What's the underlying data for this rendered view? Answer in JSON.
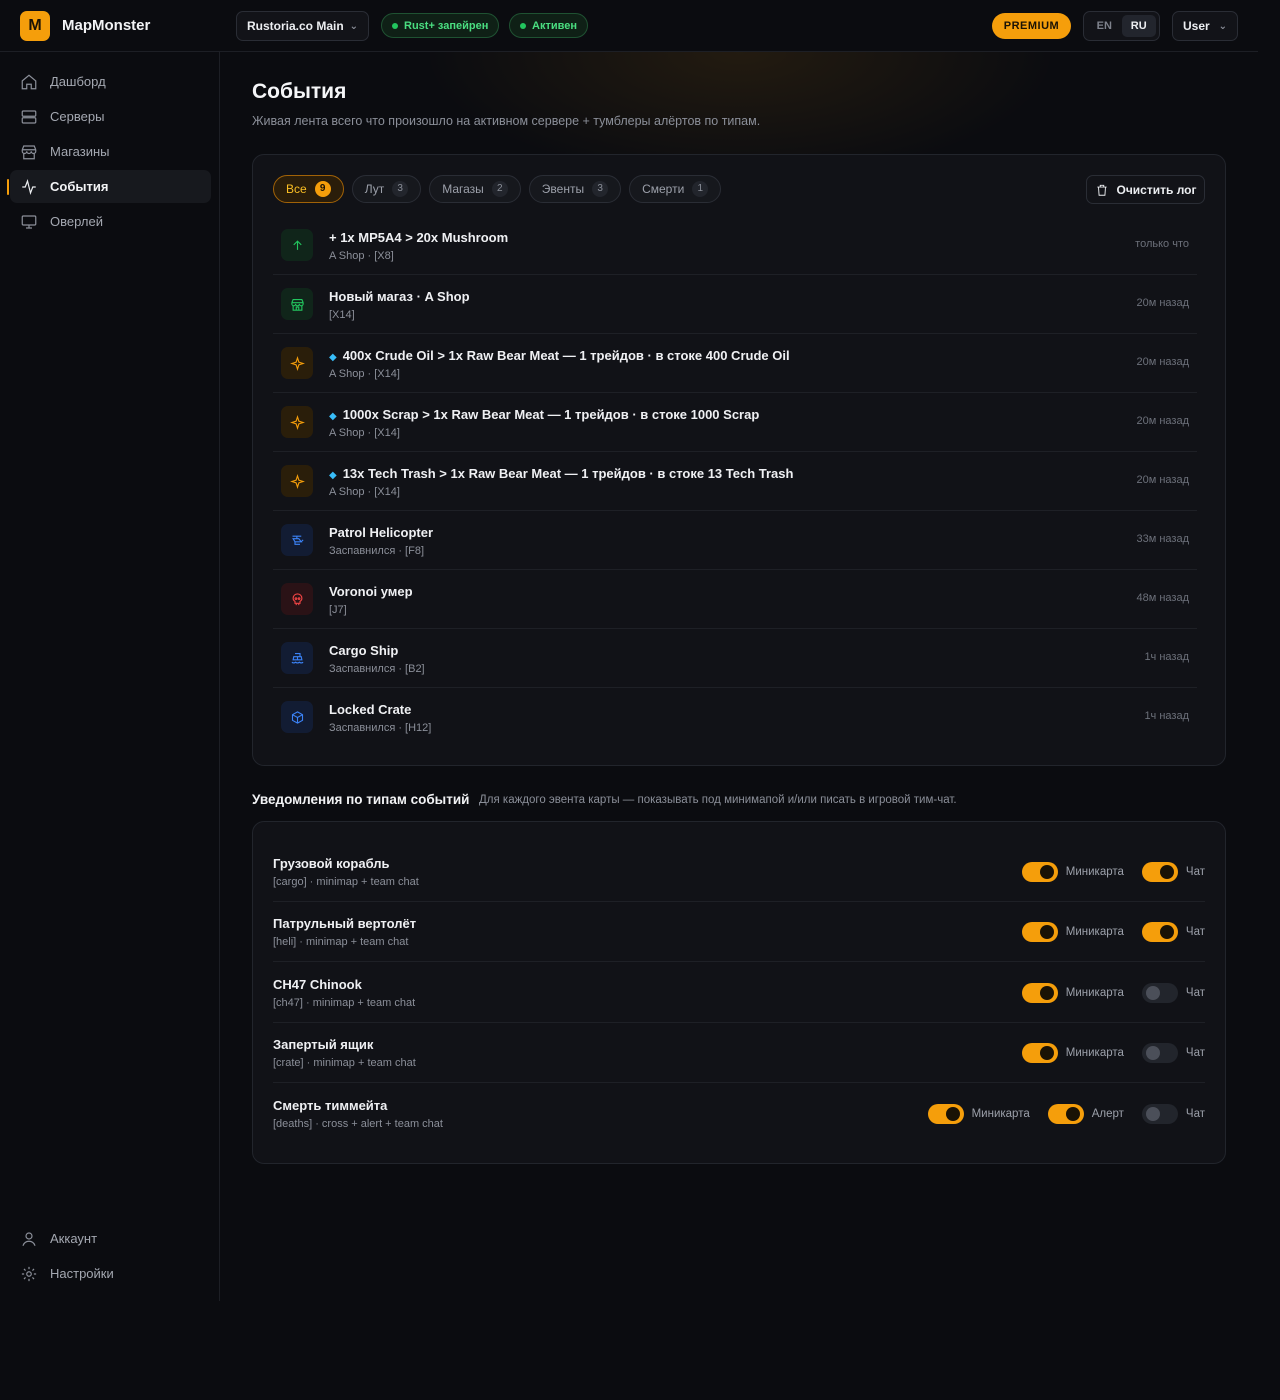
{
  "header": {
    "logo_letter": "M",
    "app_name": "MapMonster",
    "server": "Rustoria.co Main",
    "status_paired": "Rust+ запейрен",
    "status_active": "Активен",
    "premium": "PREMIUM",
    "lang_en": "EN",
    "lang_ru": "RU",
    "user": "User"
  },
  "sidebar": {
    "items": [
      {
        "label": "Дашборд",
        "icon": "home-icon"
      },
      {
        "label": "Серверы",
        "icon": "server-icon"
      },
      {
        "label": "Магазины",
        "icon": "store-icon"
      },
      {
        "label": "События",
        "icon": "activity-icon",
        "active": true
      },
      {
        "label": "Оверлей",
        "icon": "monitor-icon"
      }
    ],
    "bottom": [
      {
        "label": "Аккаунт",
        "icon": "user-icon"
      },
      {
        "label": "Настройки",
        "icon": "gear-icon"
      }
    ]
  },
  "page": {
    "title": "События",
    "subtitle": "Живая лента всего что произошло на активном сервере + тумблеры алёртов по типам."
  },
  "filters": [
    {
      "label": "Все",
      "count": "9",
      "active": true
    },
    {
      "label": "Лут",
      "count": "3"
    },
    {
      "label": "Магазы",
      "count": "2"
    },
    {
      "label": "Эвенты",
      "count": "3"
    },
    {
      "label": "Смерти",
      "count": "1"
    }
  ],
  "clear_log": "Очистить лог",
  "events": [
    {
      "icon": "arrow-up-icon",
      "color": "green",
      "gem": false,
      "title": "+ 1x MP5A4 > 20x Mushroom",
      "sub": "A Shop · [X8]",
      "time": "только что"
    },
    {
      "icon": "store-icon",
      "color": "green",
      "gem": false,
      "title": "Новый магаз · A Shop",
      "sub": "[X14]",
      "time": "20м назад"
    },
    {
      "icon": "sparkle-icon",
      "color": "amber",
      "gem": true,
      "title": "400x Crude Oil > 1x Raw Bear Meat — 1 трейдов · в стоке 400 Crude Oil",
      "sub": "A Shop · [X14]",
      "time": "20м назад"
    },
    {
      "icon": "sparkle-icon",
      "color": "amber",
      "gem": true,
      "title": "1000x Scrap > 1x Raw Bear Meat — 1 трейдов · в стоке 1000 Scrap",
      "sub": "A Shop · [X14]",
      "time": "20м назад"
    },
    {
      "icon": "sparkle-icon",
      "color": "amber",
      "gem": true,
      "title": "13x Tech Trash > 1x Raw Bear Meat — 1 трейдов · в стоке 13 Tech Trash",
      "sub": "A Shop · [X14]",
      "time": "20м назад"
    },
    {
      "icon": "helicopter-icon",
      "color": "blue",
      "gem": false,
      "title": "Patrol Helicopter",
      "sub": "Заспавнился · [F8]",
      "time": "33м назад"
    },
    {
      "icon": "skull-icon",
      "color": "red",
      "gem": false,
      "title": "Voronoi умер",
      "sub": "[J7]",
      "time": "48м назад"
    },
    {
      "icon": "ship-icon",
      "color": "blue",
      "gem": false,
      "title": "Cargo Ship",
      "sub": "Заспавнился · [B2]",
      "time": "1ч назад"
    },
    {
      "icon": "box-icon",
      "color": "blue",
      "gem": false,
      "title": "Locked Crate",
      "sub": "Заспавнился · [H12]",
      "time": "1ч назад"
    }
  ],
  "notifications": {
    "title": "Уведомления по типам событий",
    "subtitle": "Для каждого эвента карты — показывать под минимапой и/или писать в игровой тим-чат.",
    "rows": [
      {
        "title": "Грузовой корабль",
        "sub": "[cargo] · minimap + team chat",
        "toggles": [
          {
            "label": "Миникарта",
            "on": true
          },
          {
            "label": "Чат",
            "on": true
          }
        ]
      },
      {
        "title": "Патрульный вертолёт",
        "sub": "[heli] · minimap + team chat",
        "toggles": [
          {
            "label": "Миникарта",
            "on": true
          },
          {
            "label": "Чат",
            "on": true
          }
        ]
      },
      {
        "title": "CH47 Chinook",
        "sub": "[ch47] · minimap + team chat",
        "toggles": [
          {
            "label": "Миникарта",
            "on": true
          },
          {
            "label": "Чат",
            "on": false
          }
        ]
      },
      {
        "title": "Запертый ящик",
        "sub": "[crate] · minimap + team chat",
        "toggles": [
          {
            "label": "Миникарта",
            "on": true
          },
          {
            "label": "Чат",
            "on": false
          }
        ]
      },
      {
        "title": "Смерть тиммейта",
        "sub": "[deaths] · cross + alert + team chat",
        "toggles": [
          {
            "label": "Миникарта",
            "on": true
          },
          {
            "label": "Алерт",
            "on": true
          },
          {
            "label": "Чат",
            "on": false
          }
        ]
      }
    ]
  },
  "colors": {
    "accent": "#f59e0b",
    "success": "#22c55e",
    "info": "#3b82f6",
    "danger": "#ef4444",
    "background": "#0b0c10"
  }
}
